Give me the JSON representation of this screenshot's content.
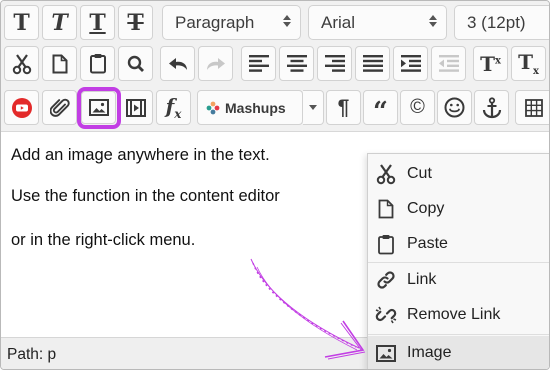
{
  "toolbar": {
    "format_select": "Paragraph",
    "font_select": "Arial",
    "size_select": "3 (12pt)",
    "mashups_label": "Mashups"
  },
  "content": {
    "lines": [
      "Add an image anywhere in the text.",
      "Use the function in the content editor",
      "or in the right-click menu."
    ]
  },
  "statusbar": {
    "path_label": "Path:",
    "path_value": "p"
  },
  "context_menu": {
    "items": [
      {
        "label": "Cut",
        "icon": "scissors-icon"
      },
      {
        "label": "Copy",
        "icon": "document-icon"
      },
      {
        "label": "Paste",
        "icon": "clipboard-icon"
      },
      {
        "label": "Link",
        "icon": "link-icon"
      },
      {
        "label": "Remove Link",
        "icon": "broken-link-icon"
      },
      {
        "label": "Image",
        "icon": "image-icon"
      }
    ]
  },
  "colors": {
    "highlight": "#c23ee4",
    "youtube_red": "#e32a2a"
  }
}
